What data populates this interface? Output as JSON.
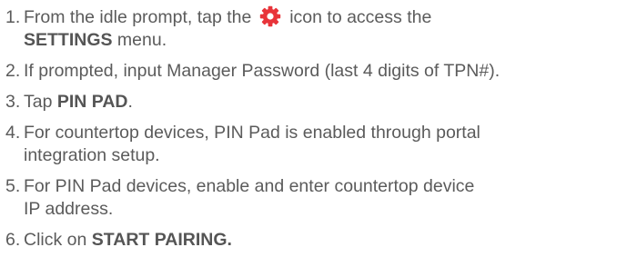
{
  "steps": [
    {
      "num": "1.",
      "text_before_icon": "From the idle prompt, tap the ",
      "icon": "settings-gear-icon",
      "text_after_icon": " icon to access the",
      "keyword": "SETTINGS",
      "text_end": " menu."
    },
    {
      "num": "2.",
      "text": "If prompted, input Manager Password (last 4 digits of TPN#)."
    },
    {
      "num": "3.",
      "text": "Tap ",
      "keyword": "PIN PAD",
      "text_end": "."
    },
    {
      "num": "4.",
      "line1": "For countertop devices, PIN Pad is enabled through portal",
      "line2": "integration setup."
    },
    {
      "num": "5.",
      "line1": "For PIN Pad devices, enable and enter countertop device",
      "line2": "IP address."
    },
    {
      "num": "6.",
      "text": "Click on ",
      "keyword": "START PAIRING."
    }
  ],
  "colors": {
    "text": "#5b5b5b",
    "gear": "#e8343a"
  }
}
